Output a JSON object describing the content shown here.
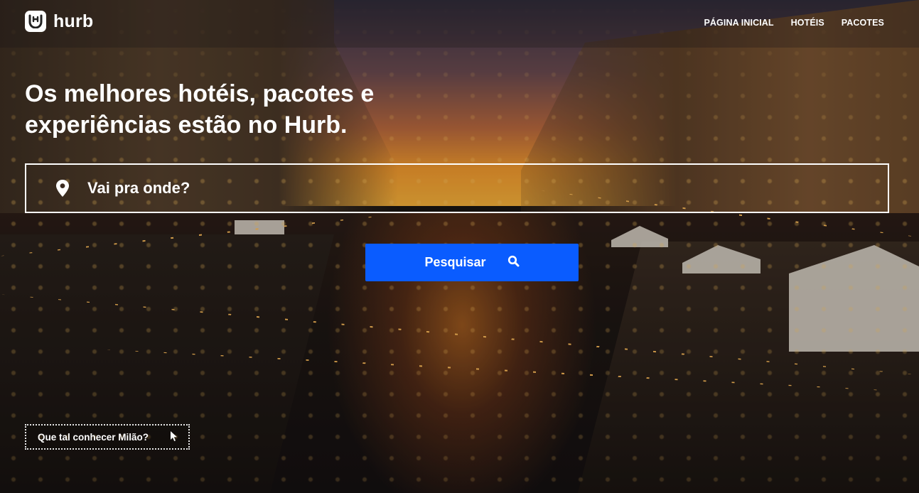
{
  "brand": {
    "name": "hurb",
    "logo_icon": "hurb-logo-icon"
  },
  "nav": {
    "items": [
      {
        "label": "PÁGINA INICIAL"
      },
      {
        "label": "HOTÉIS"
      },
      {
        "label": "PACOTES"
      }
    ]
  },
  "hero": {
    "headline_line1": "Os melhores hotéis, pacotes e",
    "headline_line2": "experiências estão no Hurb.",
    "search_placeholder": "Vai pra onde?",
    "search_icon": "map-pin-icon",
    "button_label": "Pesquisar",
    "button_icon": "search-icon",
    "suggestion_text": "Que tal conhecer Milão?",
    "suggestion_icon": "cursor-icon"
  },
  "colors": {
    "accent": "#0a5cff",
    "text": "#ffffff"
  }
}
